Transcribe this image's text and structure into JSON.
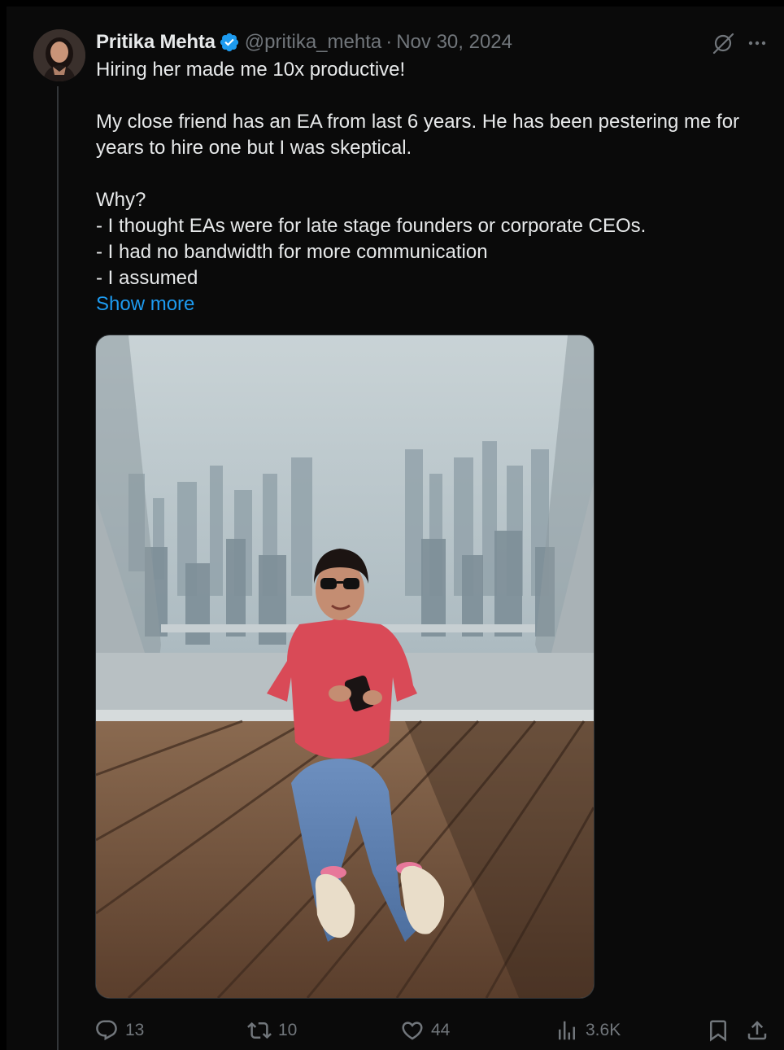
{
  "author": {
    "name": "Pritika Mehta",
    "handle": "@pritika_mehta",
    "separator": "·",
    "date": "Nov 30, 2024"
  },
  "tweet": {
    "lines": [
      "Hiring her made me 10x productive!",
      "",
      "My close friend has an EA from last 6 years. He has been pestering me for years to hire one but I was skeptical.",
      "",
      "Why?",
      "- I thought EAs were for late stage founders or corporate CEOs.",
      "- I had no bandwidth for more communication",
      "- I assumed"
    ],
    "show_more": "Show more"
  },
  "media": {
    "icon": "photo-woman-seated-observation-deck"
  },
  "actions": {
    "reply_count": "13",
    "retweet_count": "10",
    "like_count": "44",
    "views_count": "3.6K"
  },
  "colors": {
    "background": "#0a0a0a",
    "text": "#e7e9ea",
    "muted": "#71767b",
    "link": "#1d9bf0",
    "verified": "#1d9bf0"
  }
}
